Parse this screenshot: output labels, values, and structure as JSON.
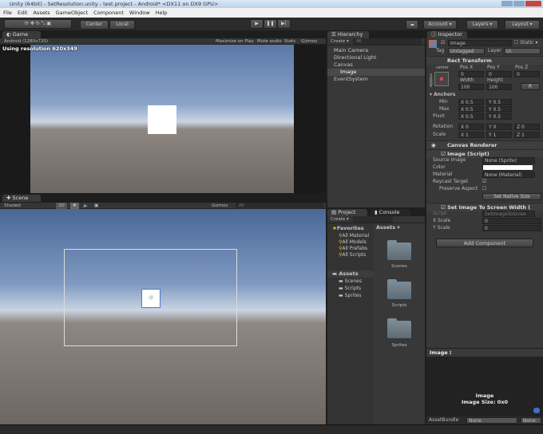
{
  "window": {
    "title": "Unity (64bit) - SetResolution.unity - test project - Android* <DX11 on DX9 GPU>"
  },
  "menu": [
    "File",
    "Edit",
    "Assets",
    "GameObject",
    "Component",
    "Window",
    "Help"
  ],
  "toolbar": {
    "center": "Center",
    "local": "Local",
    "account": "Account",
    "layers": "Layers",
    "layout": "Layout"
  },
  "game": {
    "tab": "Game",
    "aspect": "Android (1280x720)",
    "maximize": "Maximize on Play",
    "mute": "Mute audio",
    "stats": "Stats",
    "gizmos": "Gizmos",
    "overlay": "Using resolution 620x349"
  },
  "scene": {
    "tab": "Scene",
    "shading": "Shaded",
    "mode2d": "2D",
    "gizmos": "Gizmos",
    "search": "All"
  },
  "hierarchy": {
    "tab": "Hierarchy",
    "create": "Create",
    "search": "All",
    "items": [
      {
        "label": "Main Camera"
      },
      {
        "label": "Directional Light"
      },
      {
        "label": "Canvas"
      },
      {
        "label": "Image"
      },
      {
        "label": "EventSystem"
      }
    ]
  },
  "project": {
    "tab": "Project",
    "console_tab": "Console",
    "create": "Create",
    "favorites": "Favorites",
    "fav_items": [
      "All Material",
      "All Models",
      "All Prefabs",
      "All Scripts"
    ],
    "assets": "Assets",
    "asset_items": [
      "Scenes",
      "Scripts",
      "Sprites"
    ],
    "assets_header": "Assets",
    "folders": [
      "Scenes",
      "Scripts",
      "Sprites"
    ]
  },
  "inspector": {
    "tab": "Inspector",
    "name": "Image",
    "static": "Static",
    "tag_label": "Tag",
    "tag": "Untagged",
    "layer_label": "Layer",
    "layer": "UI",
    "rect": {
      "title": "Rect Transform",
      "anchor": "center",
      "side": "middle",
      "posx": "Pos X",
      "posy": "Pos Y",
      "posz": "Pos Z",
      "vx": "0",
      "vy": "0",
      "vz": "0",
      "width_label": "Width",
      "height_label": "Height",
      "w": "100",
      "h": "100",
      "r": "R",
      "anchors": "Anchors",
      "min": "Min",
      "max": "Max",
      "pivot": "Pivot",
      "rotation": "Rotation",
      "scale": "Scale",
      "x": "X",
      "y": "Y",
      "z": "Z",
      "half": "0.5",
      "zero": "0",
      "one": "1"
    },
    "canvas_renderer": "Canvas Renderer",
    "image": {
      "title": "Image (Script)",
      "source_label": "Source Image",
      "source": "None (Sprite)",
      "color_label": "Color",
      "material_label": "Material",
      "material": "None (Material)",
      "raycast": "Raycast Target",
      "preserve": "Preserve Aspect",
      "native": "Set Native Size"
    },
    "script": {
      "title": "Set Image To Screen Width (",
      "script_label": "Script",
      "script": "SetImageToScree",
      "xscale_label": "X Scale",
      "xscale": "0",
      "yscale_label": "Y Scale",
      "yscale": "0"
    },
    "add_component": "Add Component"
  },
  "preview": {
    "title": "Image",
    "name": "Image",
    "size": "Image Size: 0x0",
    "assetbundle": "AssetBundle",
    "none1": "None",
    "none2": "None"
  },
  "colors": {
    "accent": "#3e5f96",
    "panel": "#383838",
    "selection": "#4a4a4a"
  }
}
